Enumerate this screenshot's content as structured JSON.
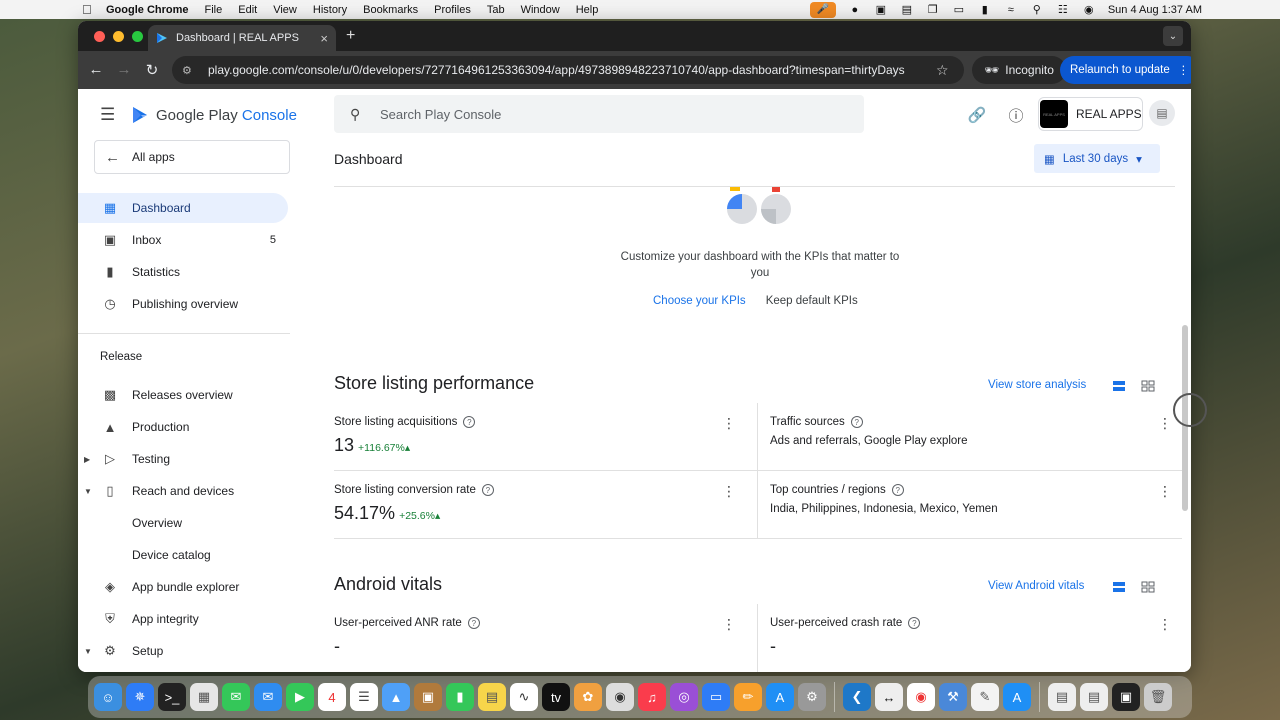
{
  "menubar": {
    "apple": "",
    "app_name": "Google Chrome",
    "menus": [
      "File",
      "Edit",
      "View",
      "History",
      "Bookmarks",
      "Profiles",
      "Tab",
      "Window",
      "Help"
    ],
    "datetime": "Sun 4 Aug  1:37 AM"
  },
  "browser": {
    "tab_title": "Dashboard | REAL APPS",
    "url": "play.google.com/console/u/0/developers/7277164961253363094/app/4973898948223710740/app-dashboard?timespan=thirtyDays",
    "incognito_label": "Incognito",
    "relaunch_label": "Relaunch to update"
  },
  "sidebar": {
    "brand_prefix": "Google Play",
    "brand_suffix": "Console",
    "all_apps": "All apps",
    "items": [
      {
        "label": "Dashboard"
      },
      {
        "label": "Inbox",
        "count": "5"
      },
      {
        "label": "Statistics"
      },
      {
        "label": "Publishing overview"
      }
    ],
    "release_label": "Release",
    "release_items": [
      {
        "label": "Releases overview"
      },
      {
        "label": "Production"
      },
      {
        "label": "Testing"
      },
      {
        "label": "Reach and devices"
      },
      {
        "label": "Overview"
      },
      {
        "label": "Device catalog"
      },
      {
        "label": "App bundle explorer"
      },
      {
        "label": "App integrity"
      },
      {
        "label": "Setup"
      }
    ]
  },
  "header": {
    "search_placeholder": "Search Play Console",
    "app_name": "REAL APPS",
    "app_logo_text": "REAL APPS",
    "page_title": "Dashboard",
    "date_range": "Last 30 days"
  },
  "kpi_prompt": {
    "text": "Customize your dashboard with the KPIs that matter to you",
    "choose_link": "Choose your KPIs",
    "keep_link": "Keep default KPIs"
  },
  "store_listing": {
    "title": "Store listing performance",
    "link": "View store analysis",
    "cards": [
      {
        "title": "Store listing acquisitions",
        "value": "13",
        "delta": "+116.67%"
      },
      {
        "title": "Traffic sources",
        "sub": "Ads and referrals, Google Play explore"
      },
      {
        "title": "Store listing conversion rate",
        "value": "54.17%",
        "delta": "+25.6%"
      },
      {
        "title": "Top countries / regions",
        "sub": "India, Philippines, Indonesia, Mexico, Yemen"
      }
    ]
  },
  "android_vitals": {
    "title": "Android vitals",
    "link": "View Android vitals",
    "cards": [
      {
        "title": "User-perceived ANR rate",
        "value": "-"
      },
      {
        "title": "User-perceived crash rate",
        "value": "-"
      }
    ]
  },
  "colors": {
    "accent": "#1a73e8",
    "positive": "#188038",
    "active_bg": "#e8f0fe",
    "relaunch": "#0b57d0"
  }
}
